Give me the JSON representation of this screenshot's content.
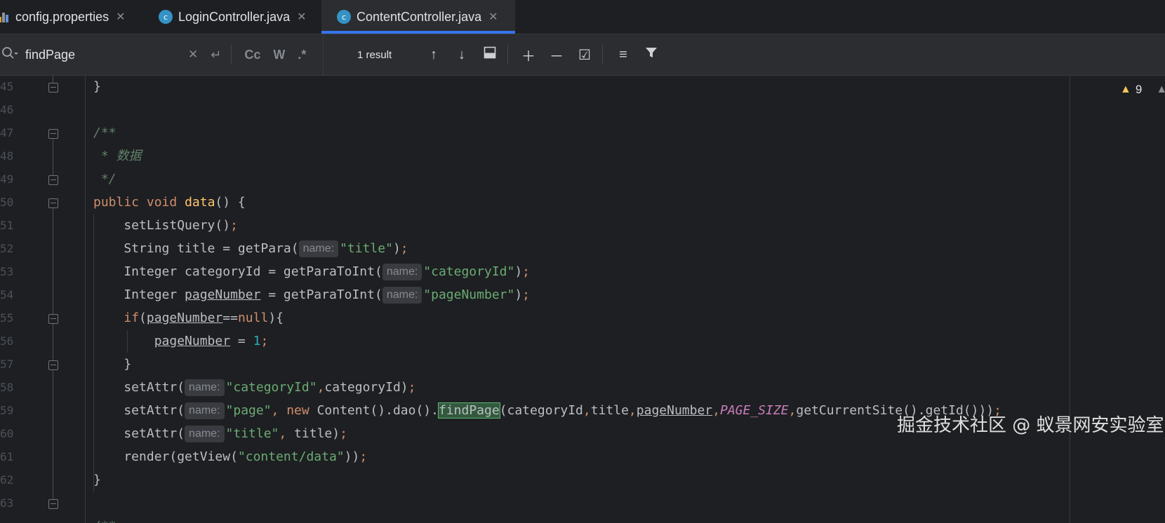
{
  "tabs": [
    {
      "label": "config.properties",
      "icon": "properties-file-icon",
      "active": false
    },
    {
      "label": "LoginController.java",
      "icon": "java-class-icon",
      "active": false
    },
    {
      "label": "ContentController.java",
      "icon": "java-class-icon",
      "active": true
    }
  ],
  "find": {
    "query": "findPage",
    "options": {
      "match_case": "Cc",
      "words": "W",
      "regex": ".*"
    },
    "result_count": "1 result"
  },
  "editor": {
    "line_numbers": [
      "45",
      "46",
      "47",
      "48",
      "49",
      "50",
      "51",
      "52",
      "53",
      "54",
      "55",
      "56",
      "57",
      "58",
      "59",
      "60",
      "61",
      "62",
      "63"
    ],
    "inspections": {
      "warnings": "9"
    },
    "hint_label": "name:",
    "strings": {
      "title": "\"title\"",
      "categoryId": "\"categoryId\"",
      "pageNumber": "\"pageNumber\"",
      "page": "\"page\"",
      "view": "\"content/data\""
    },
    "comment": "* 数据",
    "search_match": "findPage",
    "constant": "PAGE_SIZE"
  },
  "watermark": "掘金技术社区 @ 蚁景网安实验室",
  "colors": {
    "background": "#1e1f22",
    "keyword": "#cf8e6d",
    "string": "#6aab73",
    "comment": "#5f826b",
    "number": "#2aacb8",
    "match_highlight": "#32593d",
    "active_tab_indicator": "#3574f0"
  }
}
